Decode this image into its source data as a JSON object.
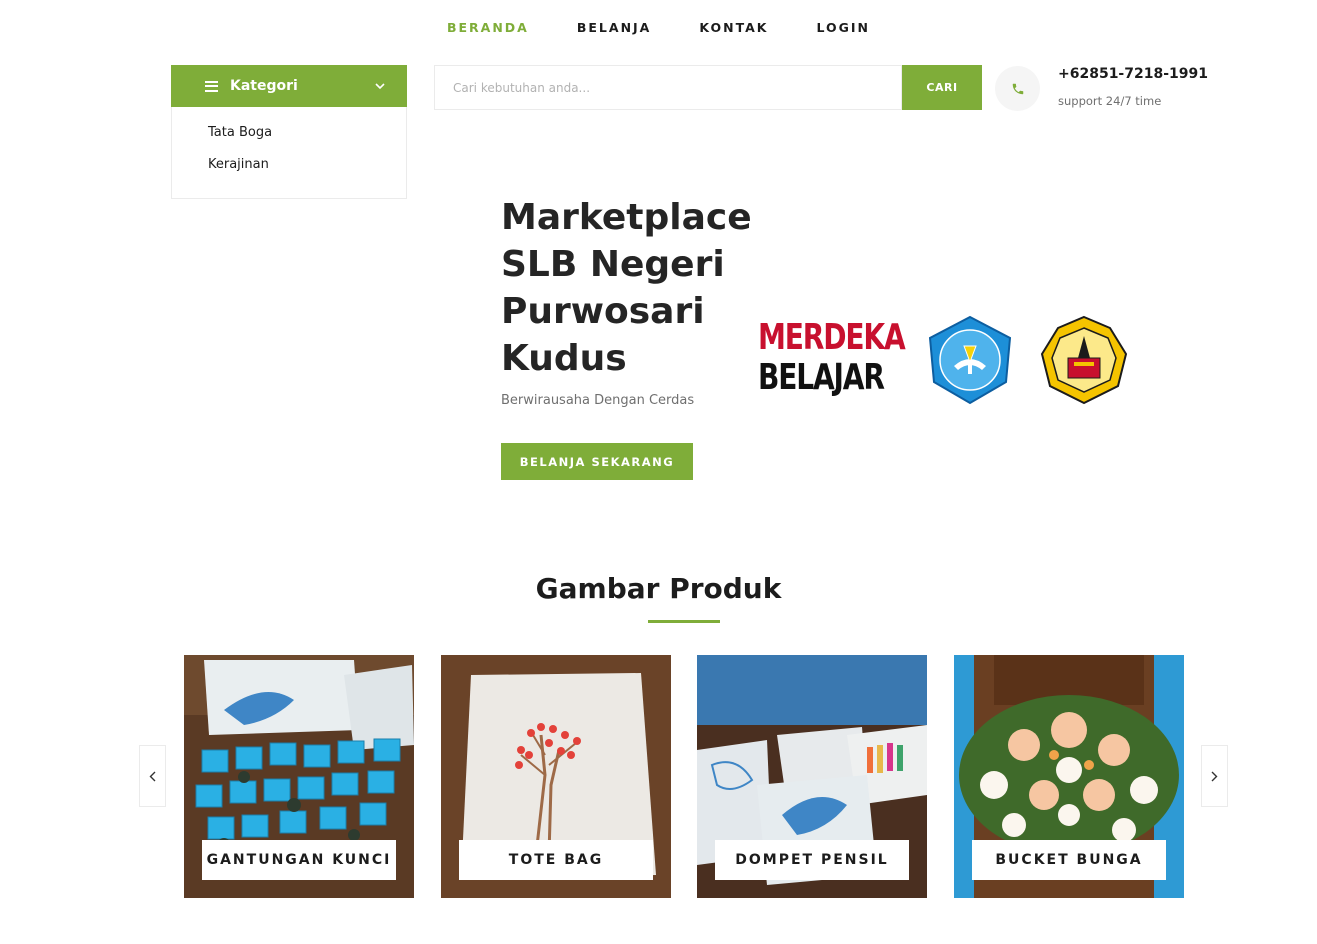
{
  "nav": {
    "items": [
      {
        "label": "BERANDA",
        "active": true
      },
      {
        "label": "BELANJA",
        "active": false
      },
      {
        "label": "KONTAK",
        "active": false
      },
      {
        "label": "LOGIN",
        "active": false
      }
    ]
  },
  "sidebar": {
    "title": "Kategori",
    "items": [
      {
        "label": "Tata Boga"
      },
      {
        "label": "Kerajinan"
      }
    ]
  },
  "search": {
    "placeholder": "Cari kebutuhan anda...",
    "button_label": "CARI"
  },
  "contact": {
    "phone": "+62851-7218-1991",
    "support": "support 24/7 time"
  },
  "hero": {
    "title_lines": [
      "Marketplace",
      "SLB Negeri",
      "Purwosari",
      "Kudus"
    ],
    "subtitle": "Berwirausaha Dengan Cerdas",
    "button_label": "BELANJA SEKARANG",
    "logo_text_1": "MERDEKA",
    "logo_text_2": "BELAJAR"
  },
  "products": {
    "section_title": "Gambar Produk",
    "items": [
      {
        "label": "GANTUNGAN KUNCI"
      },
      {
        "label": "TOTE BAG"
      },
      {
        "label": "DOMPET PENSIL"
      },
      {
        "label": "BUCKET BUNGA"
      }
    ]
  },
  "colors": {
    "accent": "#7fad39",
    "text": "#1c1c1c",
    "muted": "#6f6f6f"
  },
  "icons": {
    "menu": "menu-icon",
    "dropdown": "chevron-down-icon",
    "phone": "phone-icon",
    "prev": "chevron-left-icon",
    "next": "chevron-right-icon"
  }
}
